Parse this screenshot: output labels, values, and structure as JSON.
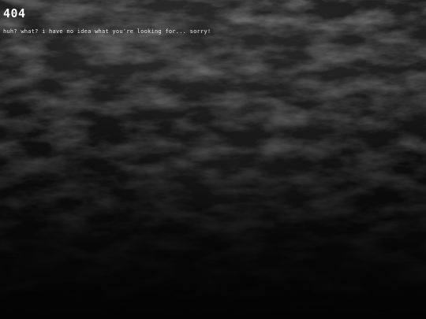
{
  "error": {
    "code": "404",
    "message": "huh? what? i have no idea what you're looking for... sorry!"
  },
  "background": {
    "texture": "dark-rocky-waves",
    "colors": {
      "top": "#1e1e1e",
      "bottom": "#030303",
      "text": "#ffffff"
    }
  }
}
